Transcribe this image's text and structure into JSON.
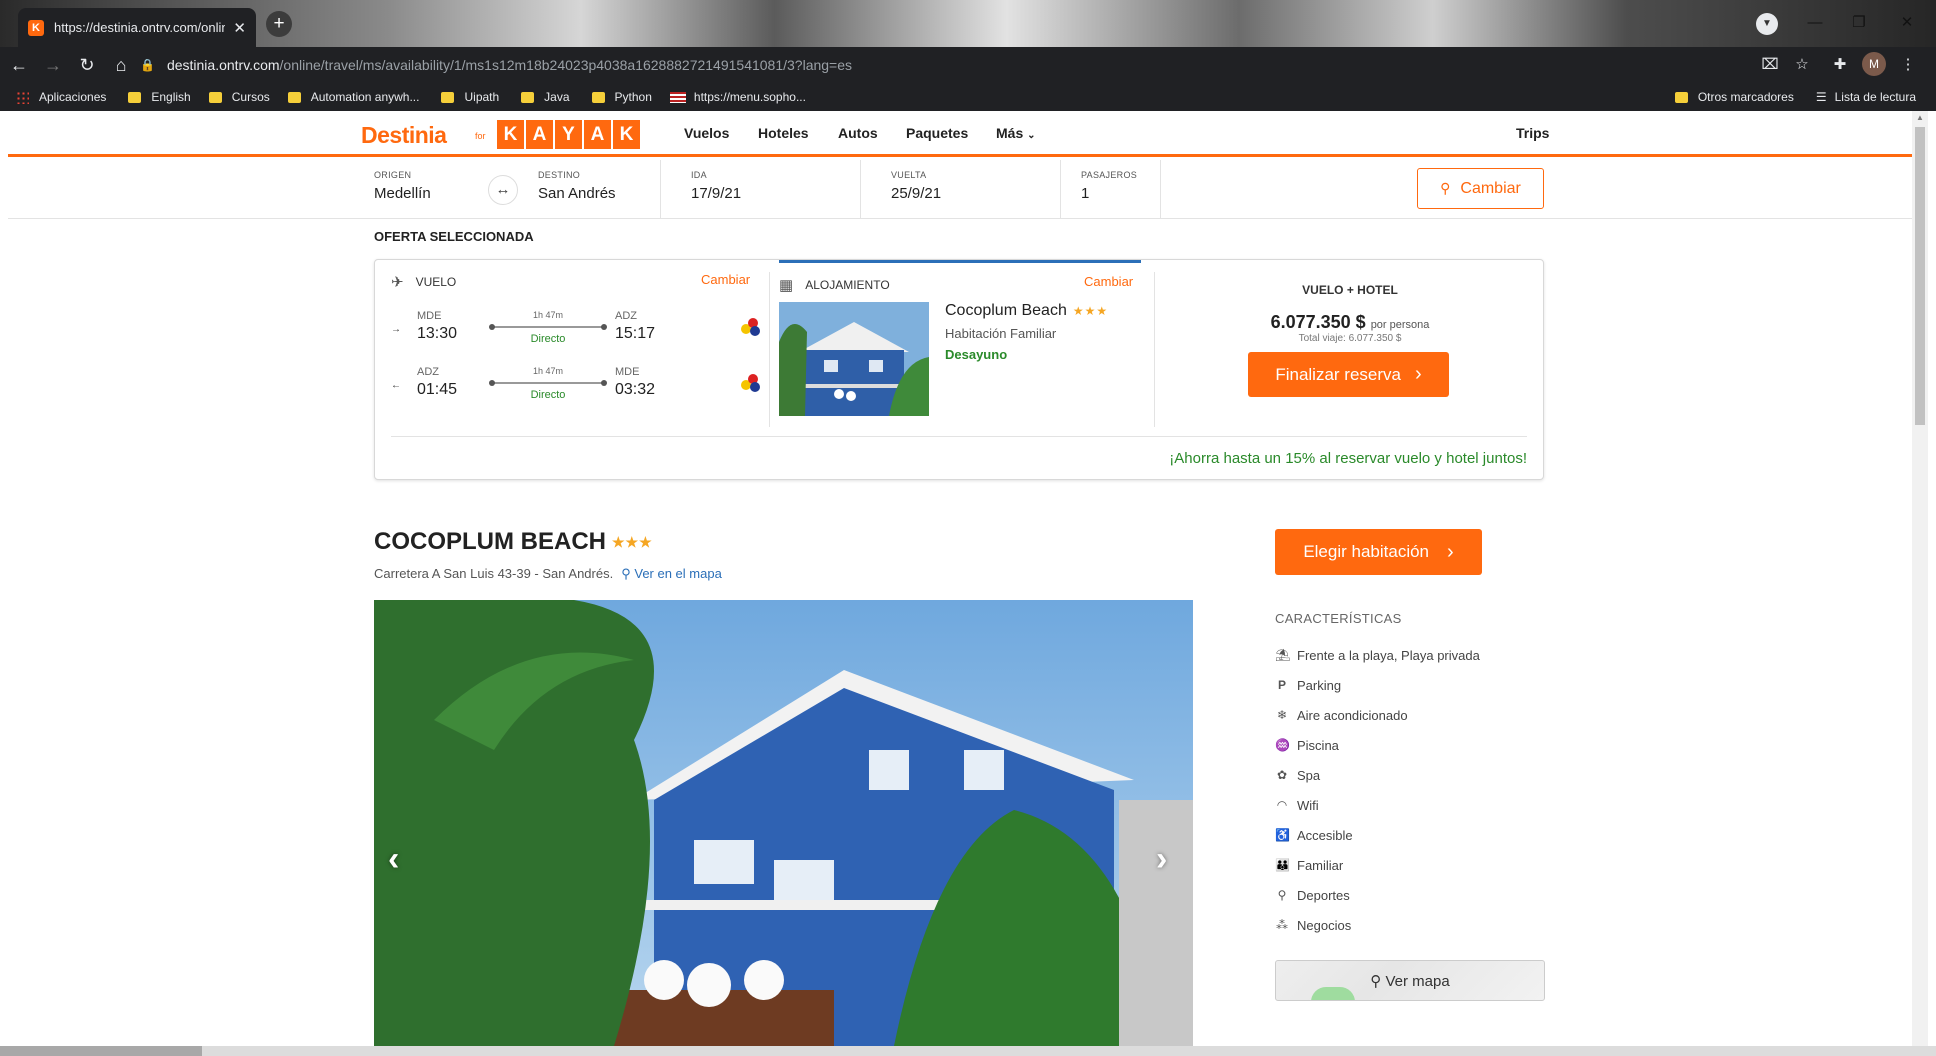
{
  "browser": {
    "tab_title": "https://destinia.ontrv.com/online",
    "tab_favicon": "K",
    "new_tab": "+",
    "url_host": "destinia.ontrv.com",
    "url_path": "/online/travel/ms/availability/1/ms1s12m18b24023p4038a1628882721491541081/3?lang=es",
    "avatar_letter": "M",
    "bookmarks": [
      {
        "label": "Aplicaciones",
        "icon": "apps-grid-icon"
      },
      {
        "label": "English",
        "icon": "folder-icon"
      },
      {
        "label": "Cursos",
        "icon": "folder-icon"
      },
      {
        "label": "Automation anywh...",
        "icon": "folder-icon"
      },
      {
        "label": "Uipath",
        "icon": "folder-icon"
      },
      {
        "label": "Java",
        "icon": "folder-icon"
      },
      {
        "label": "Python",
        "icon": "folder-icon"
      },
      {
        "label": "https://menu.sopho...",
        "icon": "flag-icon"
      }
    ],
    "bookmarks_other": "Otros marcadores",
    "reading_list": "Lista de lectura"
  },
  "site": {
    "logo_main": "Destinia",
    "logo_for": "for",
    "logo_kayak": [
      "K",
      "A",
      "Y",
      "A",
      "K"
    ],
    "nav": [
      "Vuelos",
      "Hoteles",
      "Autos",
      "Paquetes",
      "Más"
    ],
    "trips": "Trips",
    "brand_color": "#ff690f"
  },
  "search": {
    "origen_label": "ORIGEN",
    "origen": "Medellín",
    "destino_label": "DESTINO",
    "destino": "San Andrés",
    "ida_label": "IDA",
    "ida": "17/9/21",
    "vuelta_label": "VUELTA",
    "vuelta": "25/9/21",
    "pasajeros_label": "PASAJEROS",
    "pasajeros": "1",
    "cambiar": "Cambiar"
  },
  "offer": {
    "title": "OFERTA SELECCIONADA",
    "vuelo_label": "VUELO",
    "cambiar": "Cambiar",
    "flights": [
      {
        "from": "MDE",
        "dep": "13:30",
        "duration": "1h 47m",
        "type": "Directo",
        "to": "ADZ",
        "arr": "15:17",
        "direction": "→"
      },
      {
        "from": "ADZ",
        "dep": "01:45",
        "duration": "1h 47m",
        "type": "Directo",
        "to": "MDE",
        "arr": "03:32",
        "direction": "←"
      }
    ],
    "alojamiento_label": "ALOJAMIENTO",
    "hotel_name": "Cocoplum Beach",
    "hotel_stars": "★★★",
    "room": "Habitación Familiar",
    "board": "Desayuno",
    "combo_label": "VUELO + HOTEL",
    "price": "6.077.350 $",
    "per_person": "por persona",
    "total": "Total viaje: 6.077.350 $",
    "finalizar": "Finalizar reserva",
    "ahorra": "¡Ahorra hasta un 15% al reservar vuelo y hotel juntos!"
  },
  "hotel": {
    "title": "COCOPLUM BEACH",
    "stars": "★★★",
    "address": "Carretera A San Luis 43-39 - San Andrés.",
    "map_link": "Ver en el mapa",
    "elegir": "Elegir habitación",
    "features_title": "CARACTERÍSTICAS",
    "features": [
      {
        "label": "Frente a la playa, Playa privada",
        "icon": "beach-icon"
      },
      {
        "label": "Parking",
        "icon": "parking-icon"
      },
      {
        "label": "Aire acondicionado",
        "icon": "snowflake-icon"
      },
      {
        "label": "Piscina",
        "icon": "pool-icon"
      },
      {
        "label": "Spa",
        "icon": "lotus-icon"
      },
      {
        "label": "Wifi",
        "icon": "wifi-icon"
      },
      {
        "label": "Accesible",
        "icon": "wheelchair-icon"
      },
      {
        "label": "Familiar",
        "icon": "family-icon"
      },
      {
        "label": "Deportes",
        "icon": "racket-icon"
      },
      {
        "label": "Negocios",
        "icon": "business-icon"
      }
    ],
    "ver_mapa": "Ver mapa"
  }
}
